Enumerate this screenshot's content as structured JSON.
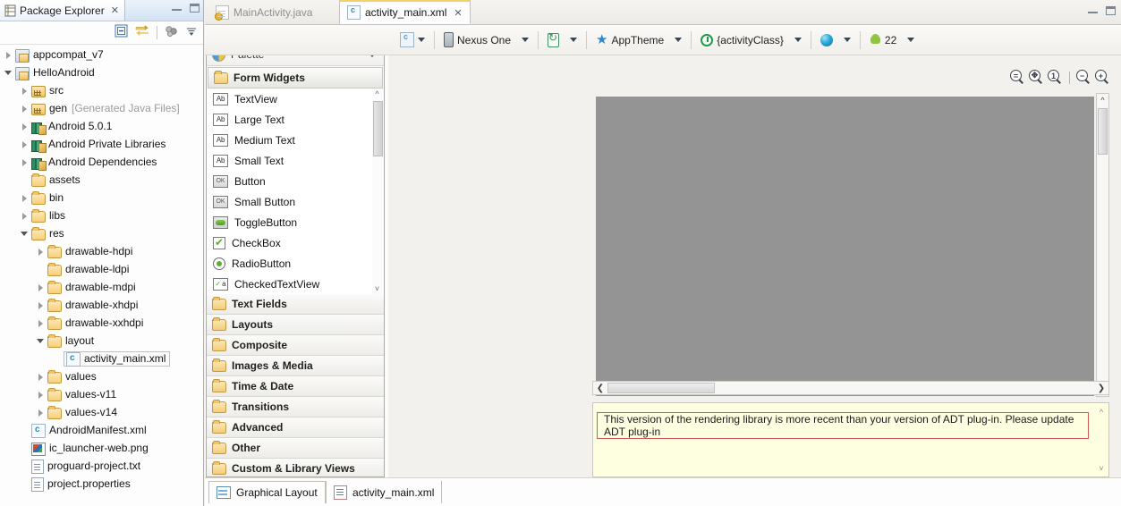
{
  "package_explorer": {
    "tab_title": "Package Explorer",
    "tab_close": "✕",
    "toolbar": {
      "collapse_all": "collapse-all-icon",
      "link_with_editor": "link-with-editor-icon",
      "focus": "focus-icon",
      "view_menu": "view-menu-icon"
    },
    "tree": [
      {
        "label": "appcompat_v7",
        "indent": 1,
        "arrow": "closed",
        "icon": "project",
        "dim": ""
      },
      {
        "label": "HelloAndroid",
        "indent": 1,
        "arrow": "open",
        "icon": "project",
        "dim": ""
      },
      {
        "label": "src",
        "indent": 2,
        "arrow": "closed",
        "icon": "srcfolder",
        "dim": ""
      },
      {
        "label": "gen",
        "indent": 2,
        "arrow": "closed",
        "icon": "srcfolder",
        "dim": "[Generated Java Files]"
      },
      {
        "label": "Android 5.0.1",
        "indent": 2,
        "arrow": "closed",
        "icon": "lib",
        "dim": ""
      },
      {
        "label": "Android Private Libraries",
        "indent": 2,
        "arrow": "closed",
        "icon": "lib",
        "dim": ""
      },
      {
        "label": "Android Dependencies",
        "indent": 2,
        "arrow": "closed",
        "icon": "lib",
        "dim": ""
      },
      {
        "label": "assets",
        "indent": 2,
        "arrow": "none",
        "icon": "folder",
        "dim": ""
      },
      {
        "label": "bin",
        "indent": 2,
        "arrow": "closed",
        "icon": "folder",
        "dim": ""
      },
      {
        "label": "libs",
        "indent": 2,
        "arrow": "closed",
        "icon": "folder",
        "dim": ""
      },
      {
        "label": "res",
        "indent": 2,
        "arrow": "open",
        "icon": "folder",
        "dim": ""
      },
      {
        "label": "drawable-hdpi",
        "indent": 3,
        "arrow": "closed",
        "icon": "folder",
        "dim": ""
      },
      {
        "label": "drawable-ldpi",
        "indent": 3,
        "arrow": "none",
        "icon": "folder",
        "dim": ""
      },
      {
        "label": "drawable-mdpi",
        "indent": 3,
        "arrow": "closed",
        "icon": "folder",
        "dim": ""
      },
      {
        "label": "drawable-xhdpi",
        "indent": 3,
        "arrow": "closed",
        "icon": "folder",
        "dim": ""
      },
      {
        "label": "drawable-xxhdpi",
        "indent": 3,
        "arrow": "closed",
        "icon": "folder",
        "dim": ""
      },
      {
        "label": "layout",
        "indent": 3,
        "arrow": "open",
        "icon": "folder",
        "dim": ""
      },
      {
        "label": "activity_main.xml",
        "indent": 4,
        "arrow": "none",
        "icon": "xml",
        "dim": "",
        "selected": true
      },
      {
        "label": "values",
        "indent": 3,
        "arrow": "closed",
        "icon": "folder",
        "dim": ""
      },
      {
        "label": "values-v11",
        "indent": 3,
        "arrow": "closed",
        "icon": "folder",
        "dim": ""
      },
      {
        "label": "values-v14",
        "indent": 3,
        "arrow": "closed",
        "icon": "folder",
        "dim": ""
      },
      {
        "label": "AndroidManifest.xml",
        "indent": 2,
        "arrow": "none",
        "icon": "xml",
        "dim": ""
      },
      {
        "label": "ic_launcher-web.png",
        "indent": 2,
        "arrow": "none",
        "icon": "png",
        "dim": ""
      },
      {
        "label": "proguard-project.txt",
        "indent": 2,
        "arrow": "none",
        "icon": "txt",
        "dim": ""
      },
      {
        "label": "project.properties",
        "indent": 2,
        "arrow": "none",
        "icon": "txt",
        "dim": ""
      }
    ]
  },
  "palette": {
    "title": "Palette",
    "header_label": "Palette",
    "active_category": "Form Widgets",
    "widgets": [
      {
        "label": "TextView",
        "glyph": "Ab",
        "kind": "ab"
      },
      {
        "label": "Large Text",
        "glyph": "Ab",
        "kind": "ab"
      },
      {
        "label": "Medium Text",
        "glyph": "Ab",
        "kind": "ab"
      },
      {
        "label": "Small Text",
        "glyph": "Ab",
        "kind": "ab"
      },
      {
        "label": "Button",
        "glyph": "OK",
        "kind": "ok"
      },
      {
        "label": "Small Button",
        "glyph": "OK",
        "kind": "ok"
      },
      {
        "label": "ToggleButton",
        "glyph": "",
        "kind": "toggle"
      },
      {
        "label": "CheckBox",
        "glyph": "",
        "kind": "check"
      },
      {
        "label": "RadioButton",
        "glyph": "",
        "kind": "radio"
      },
      {
        "label": "CheckedTextView",
        "glyph": "a",
        "kind": "ctv"
      }
    ],
    "categories": [
      "Text Fields",
      "Layouts",
      "Composite",
      "Images & Media",
      "Time & Date",
      "Transitions",
      "Advanced",
      "Other",
      "Custom & Library Views"
    ]
  },
  "editor": {
    "tabs": [
      {
        "label": "MainActivity.java",
        "active": false,
        "icon": "java-file-icon"
      },
      {
        "label": "activity_main.xml",
        "active": true,
        "icon": "xml-file-icon",
        "close": "✕"
      }
    ],
    "toolbar": {
      "config_label": "",
      "device": "Nexus One",
      "orientation": "",
      "theme": "AppTheme",
      "activity": "{activityClass}",
      "locale": "",
      "api_level": "22"
    },
    "zoom_controls": [
      {
        "name": "zoom-fit-width-icon",
        "sym": "="
      },
      {
        "name": "zoom-fit-best-icon",
        "sym": "✥"
      },
      {
        "name": "zoom-actual-size-icon",
        "sym": "1"
      },
      {
        "name": "zoom-out-icon",
        "sym": "−"
      },
      {
        "name": "zoom-in-icon",
        "sym": "+"
      }
    ],
    "canvas_color": "#949494",
    "warning_text": "This version of the rendering library is more recent than your version of ADT plug-in. Please update ADT plug-in",
    "warning_border_color": "#cf5a5a",
    "warning_bg_color": "#feffe1",
    "bottom_tabs": [
      {
        "label": "Graphical Layout",
        "selected": true,
        "icon": "graphical-layout-icon"
      },
      {
        "label": "activity_main.xml",
        "selected": false,
        "icon": "xml-source-icon"
      }
    ]
  }
}
